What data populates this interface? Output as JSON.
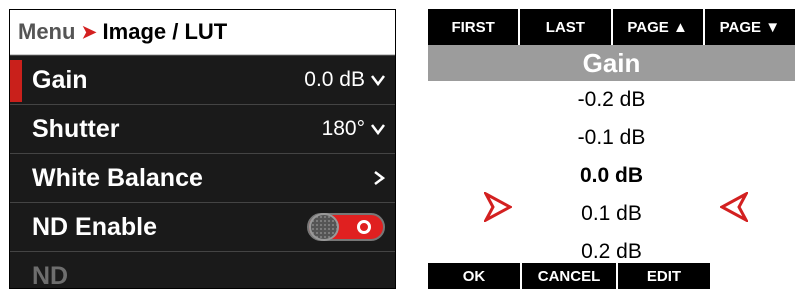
{
  "menu": {
    "breadcrumb": {
      "root": "Menu",
      "separator": "➤",
      "current": "Image / LUT"
    },
    "items": [
      {
        "label": "Gain",
        "value": "0.0 dB",
        "icon": "chevron-down-icon"
      },
      {
        "label": "Shutter",
        "value": "180°",
        "icon": "chevron-down-icon"
      },
      {
        "label": "White Balance",
        "value": "",
        "icon": "chevron-right-icon"
      },
      {
        "label": "ND Enable",
        "value": "",
        "icon": "toggle-icon",
        "toggle_on": true
      },
      {
        "label": "ND",
        "value": "",
        "disabled": true
      }
    ]
  },
  "picker": {
    "nav": {
      "first": "FIRST",
      "last": "LAST",
      "page_up": "PAGE ▲",
      "page_down": "PAGE ▼"
    },
    "title": "Gain",
    "options": [
      "-0.2 dB",
      "-0.1 dB",
      "0.0 dB",
      "0.1 dB",
      "0.2 dB"
    ],
    "selected_option": "0.0 dB",
    "actions": {
      "ok": "OK",
      "cancel": "CANCEL",
      "edit": "EDIT"
    }
  },
  "colors": {
    "accent_red": "#c9201b",
    "menu_bg": "#1a1a1a",
    "title_bar": "#9c9c9c"
  }
}
